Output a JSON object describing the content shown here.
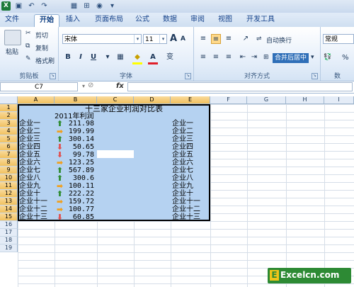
{
  "qat": {
    "app_icon": "X",
    "icons": [
      "save-icon",
      "undo-icon",
      "redo-icon",
      "grid-icon",
      "insert-icon",
      "toggle-icon",
      "dropdown-icon"
    ]
  },
  "tabs": [
    "文件",
    "开始",
    "插入",
    "页面布局",
    "公式",
    "数据",
    "审阅",
    "视图",
    "开发工具"
  ],
  "active_tab": "开始",
  "ribbon": {
    "clipboard": {
      "paste": "粘贴",
      "cut": "剪切",
      "copy": "复制",
      "format_painter": "格式刷",
      "group": "剪贴板"
    },
    "font": {
      "name": "宋体",
      "size": "11",
      "bold": "B",
      "italic": "I",
      "underline": "U",
      "grow": "A",
      "shrink": "A",
      "font_color": "A",
      "phonetic": "变",
      "group": "字体"
    },
    "alignment": {
      "wrap": "自动换行",
      "merge": "合并后居中",
      "group": "对齐方式"
    },
    "number": {
      "format": "常规",
      "percent": "%",
      "group": "数"
    }
  },
  "formula_bar": {
    "name_box": "C7",
    "fx": "fx",
    "content": ""
  },
  "columns": [
    "A",
    "B",
    "C",
    "D",
    "E",
    "F",
    "G",
    "H",
    "I"
  ],
  "rows": [
    "1",
    "2",
    "3",
    "4",
    "5",
    "6",
    "7",
    "8",
    "9",
    "10",
    "11",
    "12",
    "13",
    "14",
    "15",
    "16",
    "17",
    "18",
    "19"
  ],
  "sheet": {
    "title": "十三家企业利润对比表",
    "subtitle": "2011年利润",
    "records": [
      {
        "company": "企业一",
        "value": "211.98",
        "trend": "up",
        "label": "企业一"
      },
      {
        "company": "企业二",
        "value": "199.99",
        "trend": "flat",
        "label": "企业二"
      },
      {
        "company": "企业三",
        "value": "300.14",
        "trend": "up",
        "label": "企业三"
      },
      {
        "company": "企业四",
        "value": "50.65",
        "trend": "down",
        "label": "企业四"
      },
      {
        "company": "企业五",
        "value": "99.78",
        "trend": "down",
        "label": "企业五"
      },
      {
        "company": "企业六",
        "value": "123.25",
        "trend": "flat",
        "label": "企业六"
      },
      {
        "company": "企业七",
        "value": "567.89",
        "trend": "up",
        "label": "企业七"
      },
      {
        "company": "企业八",
        "value": "300.6",
        "trend": "up",
        "label": "企业八"
      },
      {
        "company": "企业九",
        "value": "100.11",
        "trend": "flat",
        "label": "企业九"
      },
      {
        "company": "企业十",
        "value": "222.22",
        "trend": "up",
        "label": "企业十"
      },
      {
        "company": "企业十一",
        "value": "159.72",
        "trend": "flat",
        "label": "企业十一"
      },
      {
        "company": "企业十二",
        "value": "100.77",
        "trend": "flat",
        "label": "企业十二"
      },
      {
        "company": "企业十三",
        "value": "60.85",
        "trend": "down",
        "label": "企业十三"
      }
    ]
  },
  "colors": {
    "up": "#2e8b2e",
    "flat": "#f0a020",
    "down": "#e05050",
    "selection": "#b5d2f1"
  },
  "watermark": {
    "text": "Excelcn.com",
    "letter": "E"
  }
}
